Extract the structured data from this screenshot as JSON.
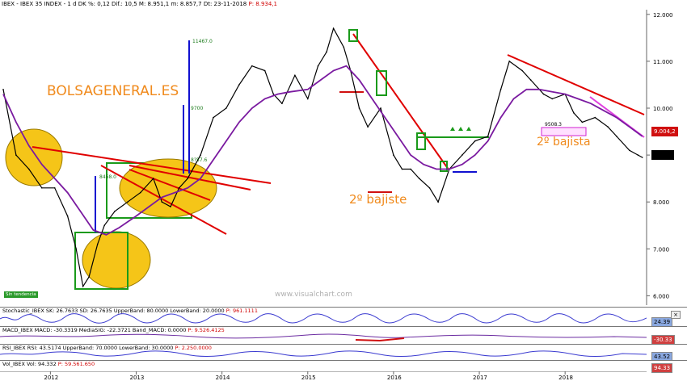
{
  "header": {
    "symbol": "IBEX - IBEX 35 INDEX",
    "info": "- 1 d DK %: 0,12 Dif.: 10,5 M: 8.951,1 m: 8.857,7 Dt: 23-11-2018",
    "last": "P: 8.934,1"
  },
  "watermark": "BOLSAGENERAL.ES",
  "site": "www.visualchart.com",
  "annotations": {
    "bajista_mid": "2º bajiste",
    "bajista_right": "2º bajista",
    "box_label_right": "9508.3",
    "tip_high": "11467.0",
    "tip_mid": "9700",
    "tip_low": "8468.0",
    "tip_small": "8?57.6",
    "corner_tag": "Sin tendencia"
  },
  "price_tags": {
    "current": "9.004,2",
    "dark": ""
  },
  "panels": {
    "stoch": {
      "label": "Stochastic_IBEX SK: 26.7633 SD: 26.7635 UpperBand: 80.0000 LowerBand: 20.0000",
      "last": "P: 961.1111",
      "tag": "24.39"
    },
    "macd": {
      "label": "MACD_IBEX MACD: -30.3319 MediaSIG: -22.3721 Band_MACD: 0.0000",
      "last": "P: 9.526.4125",
      "tag": "-30.33"
    },
    "rsi": {
      "label": "RSI_IBEX RSI: 43.5174 UpperBand: 70.0000 LowerBand: 30.0000",
      "last": "P: 2.250.0000",
      "tag": "43.52"
    },
    "vol": {
      "label": "Vol_IBEX Vol: 94.332",
      "last": "P: 59.561.650",
      "tag": "94.33"
    }
  },
  "chart_data": {
    "type": "line",
    "title": "IBEX - IBEX 35 INDEX",
    "xlabel": "",
    "ylabel": "",
    "x_tick_labels": [
      "2012",
      "2013",
      "2014",
      "2015",
      "2016",
      "2017",
      "2018"
    ],
    "x_tick_positions": [
      2012,
      2013,
      2014,
      2015,
      2016,
      2017,
      2018
    ],
    "xlim": [
      2011.45,
      2018.95
    ],
    "y_tick_labels": [
      "6.000",
      "7.000",
      "8.000",
      "9.000",
      "10.000",
      "11.000",
      "12.000"
    ],
    "y_ticks": [
      6000,
      7000,
      8000,
      9000,
      10000,
      11000,
      12000
    ],
    "ylim": [
      5800,
      12100
    ],
    "grid": false,
    "series": [
      {
        "name": "IBEX",
        "color": "#000000",
        "x": [
          2011.45,
          2011.6,
          2011.75,
          2011.9,
          2012.05,
          2012.2,
          2012.3,
          2012.38,
          2012.45,
          2012.55,
          2012.63,
          2012.75,
          2012.9,
          2013.05,
          2013.2,
          2013.3,
          2013.4,
          2013.5,
          2013.6,
          2013.75,
          2013.9,
          2014.05,
          2014.2,
          2014.35,
          2014.5,
          2014.6,
          2014.7,
          2014.85,
          2015.0,
          2015.12,
          2015.22,
          2015.3,
          2015.42,
          2015.5,
          2015.6,
          2015.7,
          2015.85,
          2016.0,
          2016.1,
          2016.2,
          2016.3,
          2016.42,
          2016.52,
          2016.65,
          2016.8,
          2016.95,
          2017.1,
          2017.25,
          2017.35,
          2017.5,
          2017.6,
          2017.75,
          2017.85,
          2018.0,
          2018.1,
          2018.2,
          2018.35,
          2018.5,
          2018.6,
          2018.75,
          2018.85,
          2018.9
        ],
        "y": [
          10400,
          9000,
          8700,
          8300,
          8300,
          7700,
          7000,
          6200,
          6400,
          7100,
          7500,
          7800,
          8000,
          8200,
          8500,
          8000,
          7900,
          8300,
          8500,
          9000,
          9800,
          10000,
          10500,
          10900,
          10800,
          10300,
          10100,
          10700,
          10200,
          10900,
          11200,
          11700,
          11300,
          10800,
          10000,
          9600,
          10000,
          9000,
          8700,
          8700,
          8500,
          8300,
          8000,
          8700,
          9000,
          9300,
          9400,
          10400,
          11000,
          10800,
          10600,
          10300,
          10200,
          10300,
          9900,
          9700,
          9800,
          9600,
          9400,
          9100,
          9000,
          8950
        ]
      },
      {
        "name": "MA",
        "color": "#7a1aa0",
        "x": [
          2011.45,
          2011.6,
          2011.75,
          2011.9,
          2012.05,
          2012.2,
          2012.35,
          2012.5,
          2012.65,
          2012.8,
          2013.0,
          2013.15,
          2013.3,
          2013.45,
          2013.6,
          2013.75,
          2013.9,
          2014.05,
          2014.2,
          2014.35,
          2014.5,
          2014.65,
          2014.8,
          2015.0,
          2015.15,
          2015.3,
          2015.45,
          2015.6,
          2015.75,
          2015.9,
          2016.05,
          2016.2,
          2016.35,
          2016.5,
          2016.65,
          2016.8,
          2016.95,
          2017.1,
          2017.25,
          2017.4,
          2017.55,
          2017.7,
          2017.85,
          2018.0,
          2018.15,
          2018.3,
          2018.45,
          2018.6,
          2018.75,
          2018.9
        ],
        "y": [
          10300,
          9700,
          9200,
          8800,
          8500,
          8200,
          7800,
          7400,
          7300,
          7450,
          7700,
          7900,
          8100,
          8200,
          8300,
          8500,
          8900,
          9300,
          9700,
          10000,
          10200,
          10300,
          10350,
          10400,
          10600,
          10800,
          10900,
          10600,
          10200,
          9800,
          9400,
          9000,
          8800,
          8700,
          8700,
          8800,
          9000,
          9300,
          9800,
          10200,
          10400,
          10400,
          10350,
          10300,
          10200,
          10100,
          9950,
          9800,
          9600,
          9400
        ]
      }
    ]
  }
}
